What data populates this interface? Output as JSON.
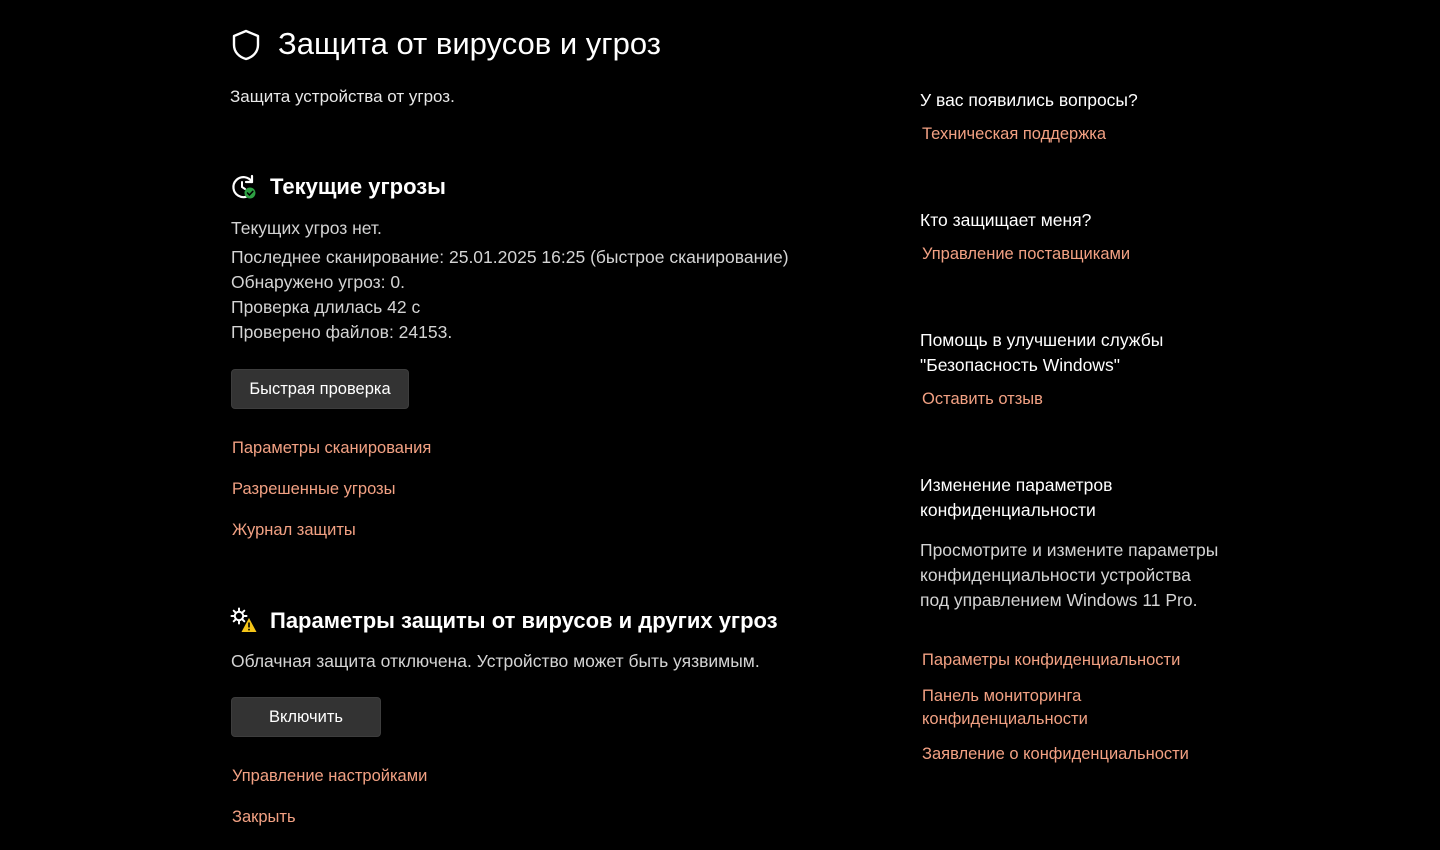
{
  "header": {
    "title": "Защита от вирусов и угроз",
    "subtitle": "Защита устройства от угроз.",
    "icon": "shield-icon"
  },
  "current_threats": {
    "icon": "refresh-check-icon",
    "title": "Текущие угрозы",
    "lines": [
      "Текущих угроз нет.",
      "Последнее сканирование: 25.01.2025 16:25 (быстрое сканирование)",
      "Обнаружено угроз: 0.",
      "Проверка длилась 42 с",
      "Проверено файлов: 24153."
    ],
    "quick_scan_button": "Быстрая проверка",
    "links": [
      "Параметры сканирования",
      "Разрешенные угрозы",
      "Журнал защиты"
    ]
  },
  "protection_settings": {
    "icon": "settings-warning-icon",
    "title": "Параметры защиты от вирусов и других угроз",
    "status": "Облачная защита отключена. Устройство может быть уязвимым.",
    "enable_button": "Включить",
    "links": [
      "Управление настройками",
      "Закрыть"
    ]
  },
  "sidebar": {
    "questions": {
      "heading": "У вас появились вопросы?",
      "link": "Техническая поддержка"
    },
    "protector": {
      "heading": "Кто защищает меня?",
      "link": "Управление поставщиками"
    },
    "feedback": {
      "heading": "Помощь в улучшении службы \"Безопасность Windows\"",
      "link": "Оставить отзыв"
    },
    "privacy": {
      "heading": "Изменение параметров конфиденциальности",
      "text": "Просмотрите и измените параметры конфиденциальности устройства под управлением Windows 11 Pro.",
      "links": [
        "Параметры конфиденциальности",
        "Панель мониторинга конфиденциальности",
        "Заявление о конфиденциальности"
      ]
    }
  },
  "colors": {
    "background": "#000000",
    "link": "#f2a183",
    "button": "#333333",
    "check_green": "#2ea043",
    "warning_yellow": "#f5c518"
  }
}
